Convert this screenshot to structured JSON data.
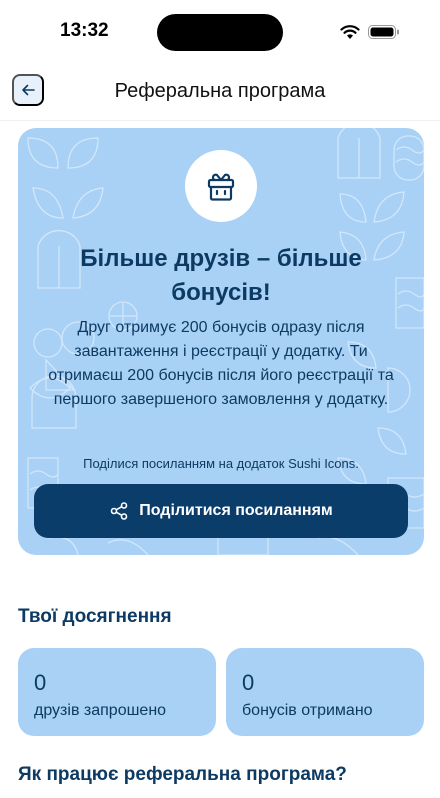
{
  "status_bar": {
    "time": "13:32"
  },
  "header": {
    "title": "Реферальна програма"
  },
  "promo": {
    "title": "Більше друзів – більше бонусів!",
    "description": "Друг отримує 200 бонусів одразу після завантаження і реєстрації у додатку. Ти отримаєш 200 бонусів після його реєстрації та першого завершеного замовлення у додатку.",
    "share_hint": "Поділися посиланням на додаток Sushi Icons.",
    "share_button": "Поділитися посиланням"
  },
  "achievements": {
    "title": "Твої досягнення",
    "stats": [
      {
        "value": "0",
        "label": "друзів запрошено"
      },
      {
        "value": "0",
        "label": "бонусів отримано"
      }
    ]
  },
  "how_it_works": {
    "title": "Як працює реферальна програма?"
  },
  "colors": {
    "accent": "#0b3d6b",
    "card": "#a9d1f5",
    "text": "#0d3a63"
  }
}
